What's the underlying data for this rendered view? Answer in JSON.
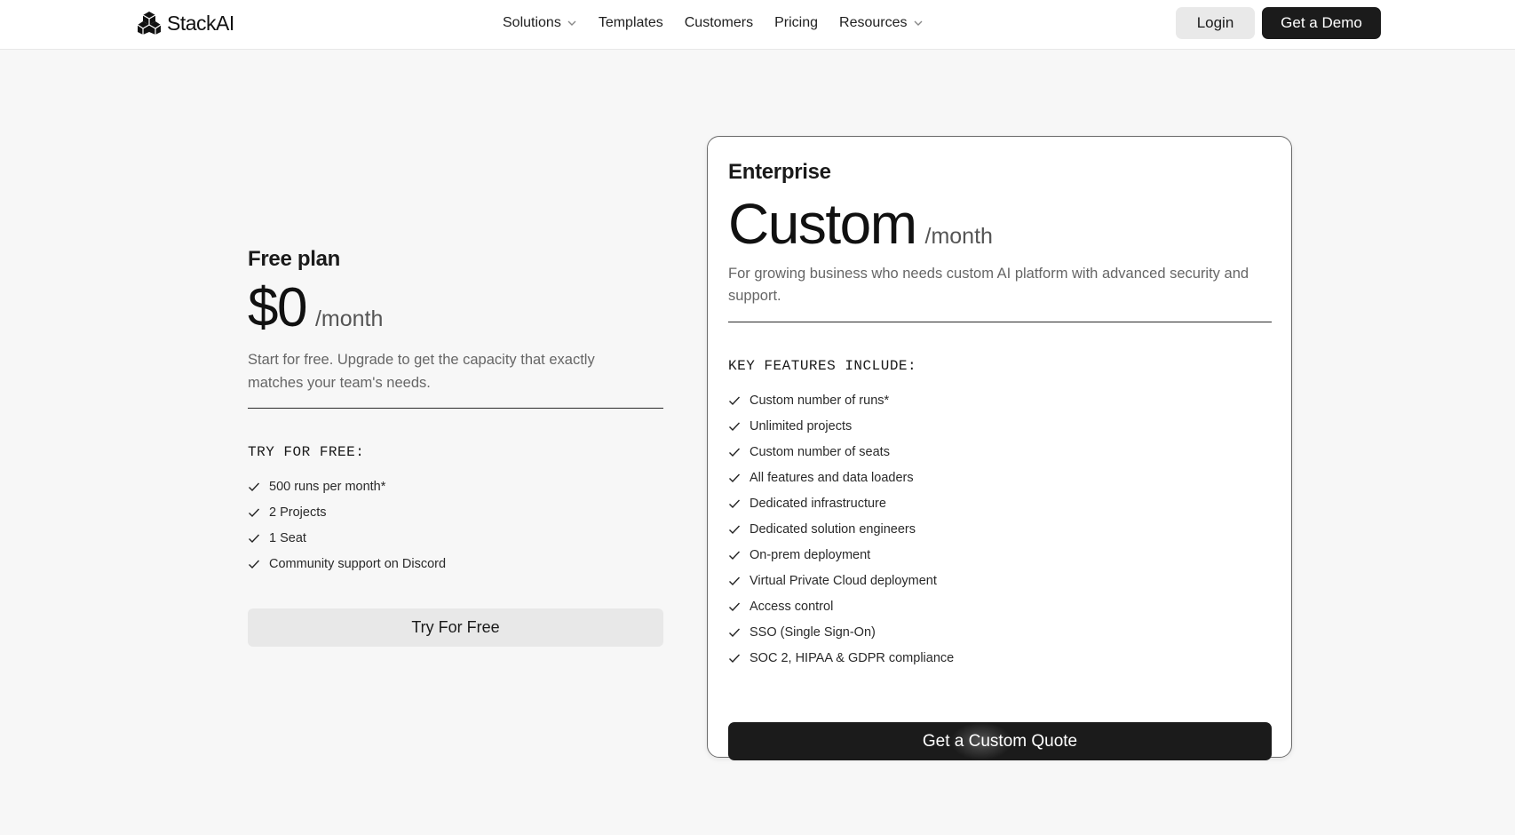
{
  "header": {
    "brand": "StackAI",
    "nav": [
      {
        "label": "Solutions",
        "has_dropdown": true
      },
      {
        "label": "Templates",
        "has_dropdown": false
      },
      {
        "label": "Customers",
        "has_dropdown": false
      },
      {
        "label": "Pricing",
        "has_dropdown": false
      },
      {
        "label": "Resources",
        "has_dropdown": true
      }
    ],
    "login_label": "Login",
    "demo_label": "Get a Demo"
  },
  "free_plan": {
    "name": "Free plan",
    "price": "$0",
    "period": "/month",
    "description": "Start for free. Upgrade to get the capacity that exactly matches your team's needs.",
    "features_title": "TRY FOR FREE:",
    "features": [
      "500 runs per month*",
      "2 Projects",
      "1 Seat",
      "Community support on Discord"
    ],
    "cta": "Try For Free"
  },
  "enterprise_plan": {
    "name": "Enterprise",
    "price": "Custom",
    "period": "/month",
    "description": "For growing business who needs custom AI platform with advanced security and support.",
    "features_title": "KEY FEATURES INCLUDE:",
    "features": [
      "Custom number of runs*",
      "Unlimited projects",
      "Custom number of seats",
      "All features and data loaders",
      "Dedicated infrastructure",
      "Dedicated solution engineers",
      "On-prem deployment",
      "Virtual Private Cloud deployment",
      "Access control",
      "SSO (Single Sign-On)",
      "SOC 2, HIPAA & GDPR compliance"
    ],
    "cta": "Get a Custom Quote"
  },
  "icons": {
    "logo": "stackai-cubes-logo-icon",
    "dropdown": "chevron-down-icon",
    "feature_check": "check-icon"
  },
  "colors": {
    "page_bg": "#f7f7f7",
    "primary_button": "#1b1b1b",
    "secondary_button": "#e9e9e9",
    "muted_text": "#666666"
  }
}
